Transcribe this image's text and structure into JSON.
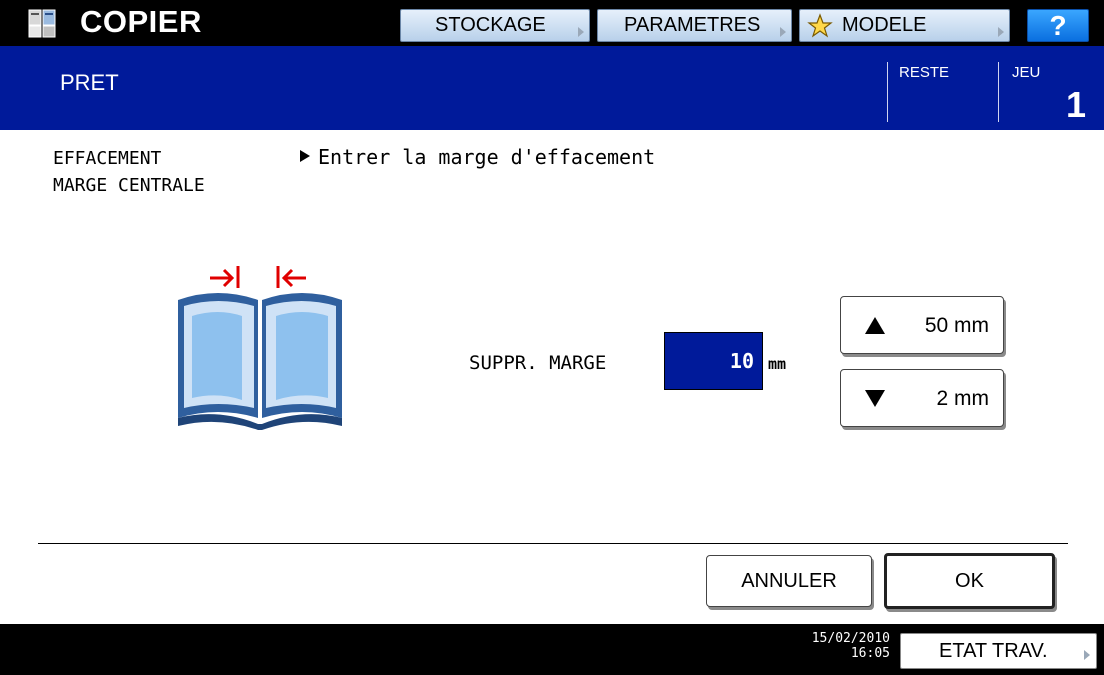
{
  "header": {
    "app_title": "COPIER",
    "app_icon": "copier-icon",
    "tabs": {
      "stockage": "STOCKAGE",
      "parametres": "PARAMETRES",
      "modele": "MODELE",
      "help": "?"
    }
  },
  "status": {
    "text": "PRET",
    "reste_label": "RESTE",
    "jeu_label": "JEU",
    "jeu_value": "1"
  },
  "function": {
    "title_line1": "EFFACEMENT",
    "title_line2": "MARGE CENTRALE",
    "instruction": "Entrer la marge d'effacement"
  },
  "margin": {
    "label": "SUPPR. MARGE",
    "value": "10",
    "unit": "mm",
    "up_label": "50 mm",
    "down_label": "2 mm"
  },
  "actions": {
    "cancel": "ANNULER",
    "ok": "OK"
  },
  "footer": {
    "date": "15/02/2010",
    "time": "16:05",
    "job_status": "ETAT TRAV."
  },
  "colors": {
    "status_band": "#001a9a",
    "top_button": "#c8dcf0",
    "help_button": "#1a86f0",
    "accent_red": "#e00000"
  }
}
